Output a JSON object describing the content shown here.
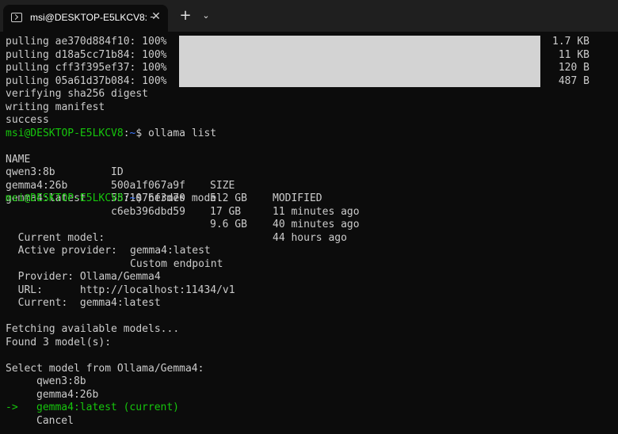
{
  "tab": {
    "title": "msi@DESKTOP-E5LKCV8: ~",
    "close": "✕"
  },
  "tabbar": {
    "new_tab": "+",
    "dropdown": "⌄"
  },
  "pull_lines": [
    {
      "text": "pulling ae370d884f10: 100%",
      "size": "1.7 KB"
    },
    {
      "text": "pulling d18a5cc71b84: 100%",
      "size": "11 KB"
    },
    {
      "text": "pulling cff3f395ef37: 100%",
      "size": "120 B"
    },
    {
      "text": "pulling 05a61d37b084: 100%",
      "size": "487 B"
    }
  ],
  "status_lines": [
    "verifying sha256 digest",
    "writing manifest",
    "success"
  ],
  "prompt": {
    "user_host": "msi@DESKTOP-E5LKCV8",
    "sep": ":",
    "path": "~",
    "dollar": "$"
  },
  "commands": {
    "list": " ollama list",
    "model": " hermes model"
  },
  "list": {
    "headers": [
      "NAME",
      "ID",
      "SIZE",
      "MODIFIED"
    ],
    "rows": [
      [
        "qwen3:8b",
        "500a1f067a9f",
        "5.2 GB",
        "11 minutes ago"
      ],
      [
        "gemma4:26b",
        "5571076f3d70",
        "17 GB",
        "40 minutes ago"
      ],
      [
        "gemma4:latest",
        "c6eb396dbd59",
        "9.6 GB",
        "44 hours ago"
      ]
    ]
  },
  "hermes": {
    "current_model_label": "  Current model:",
    "current_model_value": "gemma4:latest",
    "active_provider_label": "  Active provider:",
    "active_provider_value": "Custom endpoint",
    "provider_line": "  Provider: Ollama/Gemma4",
    "url_line": "  URL:      http://localhost:11434/v1",
    "current_line": "  Current:  gemma4:latest",
    "fetching": "Fetching available models...",
    "found": "Found 3 model(s):",
    "select": "Select model from Ollama/Gemma4:",
    "options": [
      "qwen3:8b",
      "gemma4:26b",
      "gemma4:latest (current)",
      "Cancel"
    ],
    "arrow": "->"
  }
}
